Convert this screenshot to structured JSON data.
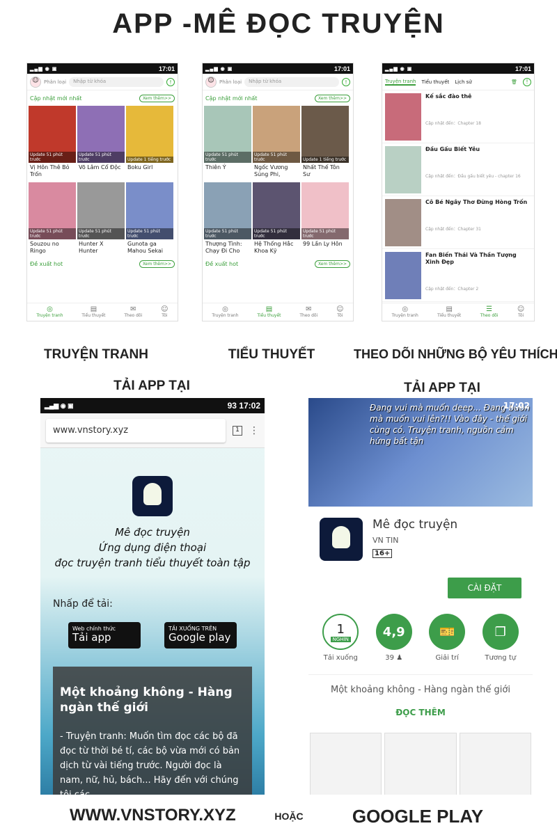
{
  "title": "APP -Mê Đọc Truyện",
  "captions": {
    "comics": "Truyện tranh",
    "novels": "Tiểu thuyết",
    "follow": "Theo dõi những bộ yêu thích",
    "get_left": "Tải app tại",
    "get_right": "Tải app tại",
    "site": "www.vnstory.xyz",
    "or": "hoặc",
    "store": "Google Play"
  },
  "status": {
    "time": "17:01",
    "time2": "17:02",
    "battery": "93"
  },
  "header": {
    "category": "Phân loại",
    "search_placeholder": "Nhập từ khóa"
  },
  "sections": {
    "latest": "Cập nhật mới nhất",
    "hot": "Đề xuất hot",
    "more": "Xem thêm>>"
  },
  "update_badge": "Update 51 phút trước",
  "update_badge2": "Update 1 tiếng trước",
  "comics": [
    {
      "title": "Vị Hôn Thê Bỏ Trốn"
    },
    {
      "title": "Võ Lâm Cổ Độc"
    },
    {
      "title": "Boku Girl"
    },
    {
      "title": "Souzou no Ringo"
    },
    {
      "title": "Hunter X Hunter"
    },
    {
      "title": "Gunota ga Mahou Sekai"
    }
  ],
  "novels": [
    {
      "title": "Thiên Ý"
    },
    {
      "title": "Ngốc Vương Sủng Phi,"
    },
    {
      "title": "Nhất Thế Tôn Sư"
    },
    {
      "title": "Thượng Tình: Chạy Đi Cho"
    },
    {
      "title": "Hệ Thống Hắc Khoa Kỹ"
    },
    {
      "title": "99 Lần Ly Hôn"
    }
  ],
  "bottom_tabs": [
    "Truyện tranh",
    "Tiểu thuyết",
    "Theo dõi",
    "Tôi"
  ],
  "follow_tabs": [
    "Truyện tranh",
    "Tiểu thuyết",
    "Lịch sử"
  ],
  "follows": [
    {
      "title": "Kế sắc đào thê",
      "update": "Cập nhật đến：Chapter 18"
    },
    {
      "title": "Đầu Gấu Biết Yêu",
      "update": "Cập nhật đến：Đầu gấu biết yêu - chapter 16"
    },
    {
      "title": "Cô Bé Ngây Thơ Đừng Hòng Trốn",
      "update": "Cập nhật đến：Chapter 31"
    },
    {
      "title": "Fan Biến Thái Và Thần Tượng Xinh Đẹp",
      "update": "Cập nhật đến：Chapter 2"
    }
  ],
  "browser": {
    "url": "www.vnstory.xyz",
    "tabs": "1",
    "line1": "Mê đọc truyện",
    "line2": "Ứng dụng điện thoại",
    "line3": "đọc truyện tranh tiểu thuyết toàn tập",
    "prompt": "Nhấp để tải:",
    "btn1_small": "Web chính thức",
    "btn1_big": "Tải app",
    "btn2_small": "TẢI XUỐNG TRÊN",
    "btn2_big": "Google play",
    "card_title": "Một khoảng không - Hàng ngàn thế giới",
    "card_body": "- Truyện tranh: Muốn tìm đọc các bộ đã đọc từ thời bé tí, các bộ vừa mới có bản dịch từ vài tiếng trước. Người đọc là nam, nữ, hủ, bách... Hãy đến với chúng tôi các"
  },
  "store": {
    "banner": "Đang vui mà muốn deep... Đang buồn mà muốn vui lên?!! Vào đây - thế giới cùng có. Truyện tranh, nguồn cảm hứng bất tận",
    "app_name": "Mê đọc truyện",
    "developer": "VN TIN",
    "rating_badge": "16+",
    "install": "CÀI ĐẶT",
    "downloads": "1",
    "downloads_unit": "NGHÌN",
    "downloads_label": "Tải xuống",
    "rating": "4,9",
    "rating_count": "39",
    "genre": "Giải trí",
    "similar": "Tương tự",
    "tagline": "Một khoảng không - Hàng ngàn thế giới",
    "read_more": "ĐỌC THÊM"
  },
  "colors": {
    "accent": "#3a9e3a",
    "install": "#3d9d4a"
  }
}
